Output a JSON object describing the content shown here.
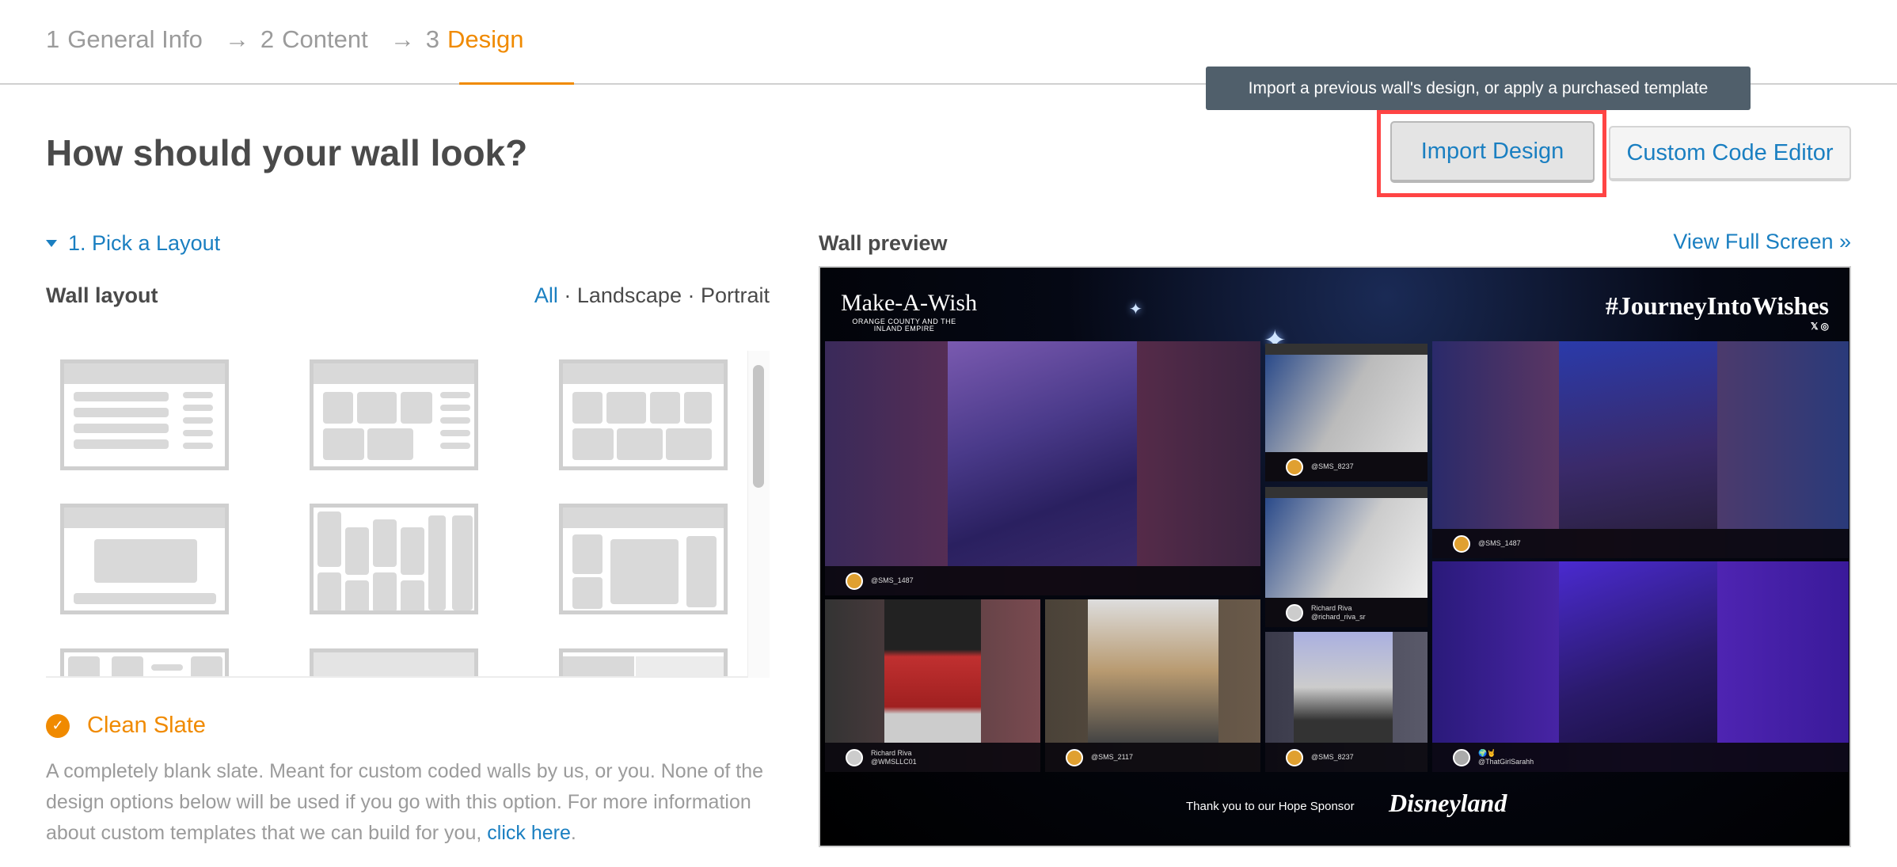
{
  "steps": [
    {
      "num": "1",
      "label": "General Info"
    },
    {
      "num": "2",
      "label": "Content"
    },
    {
      "num": "3",
      "label": "Design"
    }
  ],
  "arrow": "→",
  "tooltip": "Import a previous wall's design, or apply a purchased template",
  "buttons": {
    "import": "Import Design",
    "custom": "Custom Code Editor"
  },
  "heading": "How should your wall look?",
  "section": {
    "label": "1. Pick a Layout",
    "wall_layout": "Wall layout",
    "filters": {
      "all": "All",
      "sep": " · ",
      "landscape": "Landscape",
      "portrait": "Portrait",
      "active": "All"
    }
  },
  "selected": {
    "name": "Clean Slate",
    "description": "A completely blank slate. Meant for custom coded walls by us, or you. None of the design options below will be used if you go with this option. For more information about custom templates that we can build for you, ",
    "link": "click here",
    "end": "."
  },
  "preview": {
    "label": "Wall preview",
    "full_screen": "View Full Screen »",
    "logo": "Make-A-Wish",
    "logo_sub": "ORANGE COUNTY AND THE INLAND EMPIRE",
    "hashtag": "#JourneyIntoWishes",
    "social_icons": "twitter-icon instagram-icon",
    "tiles": [
      {
        "name": "",
        "handle": "@SMS_1487",
        "source": "sms"
      },
      {
        "name": "",
        "handle": "@SMS_8237",
        "source": "sms"
      },
      {
        "name": "Richard Riva",
        "handle": "@richard_riva_sr",
        "source": "instagram"
      },
      {
        "name": "",
        "handle": "@SMS_1487",
        "source": "sms"
      },
      {
        "name": "Richard Riva",
        "handle": "@WMSLLC01",
        "source": "twitter"
      },
      {
        "name": "",
        "handle": "@SMS_2117",
        "source": "sms"
      },
      {
        "name": "",
        "handle": "@SMS_8237",
        "source": "sms"
      },
      {
        "name": "🌍🤘",
        "handle": "@ThatGirlSarahh",
        "source": "twitter"
      }
    ],
    "sponsor_text": "Thank you to our Hope Sponsor",
    "sponsor_logo": "Disneyland"
  },
  "colors": {
    "accent": "#f08a00",
    "link": "#1a7fc1",
    "highlight": "#ff4444",
    "tooltip": "#505f6b"
  }
}
